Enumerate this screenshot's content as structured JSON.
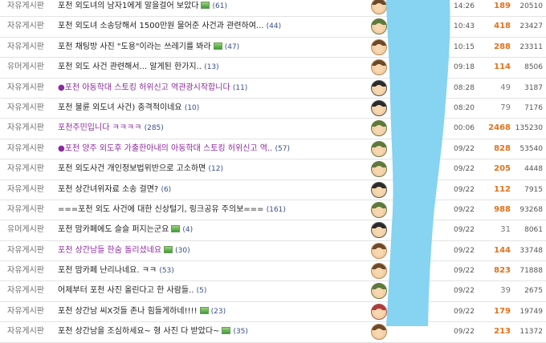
{
  "colors": {
    "scribble": "#86d3f2",
    "recommend_high": "#e2711b",
    "visited_title": "#8a2a9c"
  },
  "icons": {
    "image_attachment": "image-attachment-icon",
    "avatar": "member-level-avatar-icon"
  },
  "posts": [
    {
      "category": "자유게시판",
      "title": "포천 외도녀의 남자1에게 말을걸어 보았다",
      "has_image": true,
      "comments": "(61)",
      "avatar": "brown",
      "time": "14:26",
      "recommend": "189",
      "views": "20510",
      "title_style": "normal",
      "bullet": false
    },
    {
      "category": "자유게시판",
      "title": "포천 외도녀 소송당해서 1500만원 물어준 사건과 관련하여...",
      "has_image": false,
      "comments": "(44)",
      "avatar": "green",
      "time": "10:43",
      "recommend": "418",
      "views": "23427",
      "title_style": "normal",
      "bullet": false
    },
    {
      "category": "자유게시판",
      "title": "포천 채팅방 사진 \"도용\"이라는 쓰레기를 봐라",
      "has_image": true,
      "comments": "(47)",
      "avatar": "brown",
      "time": "10:15",
      "recommend": "288",
      "views": "23311",
      "title_style": "normal",
      "bullet": false
    },
    {
      "category": "유머게시판",
      "title": "포천 외도 사건 관련해서... 알게된 한가지..",
      "has_image": false,
      "comments": "(13)",
      "avatar": "brown",
      "time": "09:18",
      "recommend": "114",
      "views": "8506",
      "title_style": "normal",
      "bullet": false
    },
    {
      "category": "자유게시판",
      "title": "포천 아동학대 스토킹 허위신고 역관광시작합니다",
      "has_image": false,
      "comments": "(11)",
      "avatar": "dark",
      "time": "08:28",
      "recommend": "49",
      "views": "3187",
      "title_style": "notice",
      "bullet": true
    },
    {
      "category": "자유게시판",
      "title": "포천 불륜 외도녀 사건) 충격적이네요",
      "has_image": false,
      "comments": "(10)",
      "avatar": "dark",
      "time": "08:20",
      "recommend": "79",
      "views": "7176",
      "title_style": "normal",
      "bullet": false
    },
    {
      "category": "자유게시판",
      "title": "포천주민입니다 ㅋㅋㅋㅋ",
      "has_image": false,
      "comments": "(285)",
      "avatar": "green",
      "time": "00:06",
      "recommend": "2468",
      "views": "135230",
      "title_style": "visited",
      "bullet": false
    },
    {
      "category": "자유게시판",
      "title": "포천 양주 외도후 가출한아내의 아동학대 스토킹 허위신고 역..",
      "has_image": false,
      "comments": "(57)",
      "avatar": "green",
      "time": "09/22",
      "recommend": "828",
      "views": "53540",
      "title_style": "notice",
      "bullet": true
    },
    {
      "category": "자유게시판",
      "title": "포천 외도사건 개인정보법위반으로 고소하면",
      "has_image": false,
      "comments": "(12)",
      "avatar": "green",
      "time": "09/22",
      "recommend": "205",
      "views": "4448",
      "title_style": "normal",
      "bullet": false
    },
    {
      "category": "자유게시판",
      "title": "포천 상간녀위자료 소송 걸면?",
      "has_image": false,
      "comments": "(6)",
      "avatar": "dark",
      "time": "09/22",
      "recommend": "112",
      "views": "7915",
      "title_style": "normal",
      "bullet": false
    },
    {
      "category": "자유게시판",
      "title": "===포천 외도 사건에 대한 신상털기, 링크공유 주의보===",
      "has_image": false,
      "comments": "(161)",
      "avatar": "green",
      "time": "09/22",
      "recommend": "988",
      "views": "93268",
      "title_style": "normal",
      "bullet": false
    },
    {
      "category": "유머게시판",
      "title": "포천 맘카페에도 슬슬 퍼지는군요",
      "has_image": true,
      "comments": "(4)",
      "avatar": "dark",
      "time": "09/22",
      "recommend": "31",
      "views": "8061",
      "title_style": "normal",
      "bullet": false
    },
    {
      "category": "자유게시판",
      "title": "포천 상간남들 한숨 돌리셨네요",
      "has_image": true,
      "comments": "(30)",
      "avatar": "brown",
      "time": "09/22",
      "recommend": "144",
      "views": "33748",
      "title_style": "visited",
      "bullet": false
    },
    {
      "category": "자유게시판",
      "title": "포천 맘카페 난리나네요. ㅋㅋ",
      "has_image": false,
      "comments": "(53)",
      "avatar": "brown",
      "time": "09/22",
      "recommend": "823",
      "views": "71888",
      "title_style": "normal",
      "bullet": false
    },
    {
      "category": "자유게시판",
      "title": "어제부터 포천 사진 올린다고 한 사람들..",
      "has_image": false,
      "comments": "(5)",
      "avatar": "green",
      "time": "09/22",
      "recommend": "39",
      "views": "2675",
      "title_style": "normal",
      "bullet": false
    },
    {
      "category": "자유게시판",
      "title": "포천 상간남 씨X것들 존나 힘들게하네!!!!",
      "has_image": true,
      "comments": "(23)",
      "avatar": "red",
      "time": "09/22",
      "recommend": "179",
      "views": "19749",
      "title_style": "normal",
      "bullet": false
    },
    {
      "category": "자유게시판",
      "title": "포천 상간남을 조심하세요~ 형 사진 다 받았다~",
      "has_image": true,
      "comments": "(35)",
      "avatar": "brown",
      "time": "09/22",
      "recommend": "213",
      "views": "11372",
      "title_style": "normal",
      "bullet": false
    }
  ]
}
